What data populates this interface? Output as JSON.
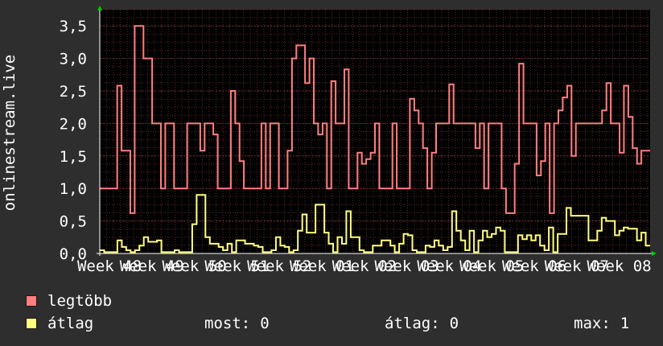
{
  "chart_data": {
    "type": "line",
    "ylabel": "onlinestream.live",
    "ylim": [
      0,
      3.75
    ],
    "yticks": [
      "0,0",
      "0,5",
      "1,0",
      "1,5",
      "2,0",
      "2,5",
      "3,0",
      "3,5"
    ],
    "ytick_values": [
      0,
      0.5,
      1.0,
      1.5,
      2.0,
      2.5,
      3.0,
      3.5
    ],
    "xticks": [
      "Week 48",
      "Week 49",
      "Week 50",
      "Week 51",
      "Week 52",
      "Week 01",
      "Week 02",
      "Week 03",
      "Week 04",
      "Week 05",
      "Week 06",
      "Week 07",
      "Week 08"
    ],
    "grid": true,
    "background": "#000000",
    "series": [
      {
        "name": "legtöbb",
        "color": "#ff7f7f",
        "values": [
          1,
          1,
          1,
          1,
          2.58,
          1.58,
          1.58,
          0.62,
          3.5,
          3.5,
          3.0,
          3.0,
          2.0,
          2.0,
          1.0,
          2.0,
          2.0,
          1.0,
          1.0,
          1.0,
          2.0,
          2.0,
          2.0,
          1.58,
          2.0,
          2.0,
          1.83,
          1.0,
          1.0,
          1.0,
          2.5,
          2.0,
          1.42,
          1.0,
          1.0,
          1.0,
          1.0,
          2.0,
          1.0,
          2.0,
          2.0,
          1.0,
          1.0,
          1.58,
          3.0,
          3.2,
          3.2,
          2.62,
          3.0,
          2.0,
          1.83,
          2.0,
          1.0,
          2.65,
          2.0,
          2.0,
          2.83,
          1.0,
          1.0,
          1.55,
          1.38,
          1.45,
          1.55,
          2.0,
          1.0,
          1.0,
          1.0,
          2.0,
          1.0,
          1.0,
          1.0,
          2.38,
          2.2,
          2.0,
          1.62,
          1.0,
          1.55,
          2.0,
          2.0,
          2.0,
          2.6,
          2.0,
          2.0,
          2.0,
          2.0,
          2.0,
          1.62,
          2.0,
          1.0,
          2.0,
          2.0,
          2.0,
          1.0,
          0.62,
          0.62,
          1.38,
          2.92,
          2.0,
          2.0,
          2.0,
          1.2,
          1.42,
          2.0,
          0.62,
          2.0,
          2.2,
          2.4,
          2.58,
          1.5,
          2.0,
          2.0,
          2.0,
          2.0,
          2.0,
          2.0,
          2.2,
          2.62,
          2.0,
          2.0,
          1.55,
          2.58,
          2.1,
          1.62,
          1.38,
          1.58,
          1.58
        ]
      },
      {
        "name": "átlag",
        "color": "#ffff80",
        "values": [
          0.05,
          0.02,
          0.02,
          0.02,
          0.2,
          0.1,
          0.05,
          0.02,
          0.05,
          0.12,
          0.25,
          0.18,
          0.18,
          0.2,
          0.02,
          0.02,
          0.02,
          0.05,
          0.02,
          0.02,
          0.02,
          0.45,
          0.9,
          0.9,
          0.25,
          0.15,
          0.15,
          0.1,
          0.05,
          0.15,
          0.02,
          0.2,
          0.2,
          0.15,
          0.15,
          0.12,
          0.1,
          0.02,
          0.02,
          0.05,
          0.25,
          0.12,
          0.1,
          0.02,
          0.05,
          0.35,
          0.6,
          0.32,
          0.32,
          0.75,
          0.75,
          0.32,
          0.15,
          0.02,
          0.25,
          0.15,
          0.65,
          0.25,
          0.25,
          0.05,
          0.02,
          0.02,
          0.12,
          0.12,
          0.2,
          0.2,
          0.12,
          0.02,
          0.15,
          0.3,
          0.28,
          0.05,
          0.02,
          0.02,
          0.12,
          0.1,
          0.2,
          0.12,
          0.05,
          0.1,
          0.65,
          0.35,
          0.2,
          0.05,
          0.35,
          0.02,
          0.2,
          0.35,
          0.25,
          0.3,
          0.4,
          0.35,
          0.02,
          0.02,
          0.02,
          0.28,
          0.22,
          0.28,
          0.2,
          0.28,
          0.12,
          0.05,
          0.4,
          0.02,
          0.3,
          0.3,
          0.7,
          0.58,
          0.58,
          0.58,
          0.58,
          0.2,
          0.2,
          0.35,
          0.55,
          0.5,
          0.5,
          0.28,
          0.35,
          0.4,
          0.38,
          0.38,
          0.2,
          0.32,
          0.12
        ]
      }
    ]
  },
  "legend": [
    {
      "label": "legtöbb",
      "color": "#ff7f7f"
    },
    {
      "label": "átlag",
      "color": "#ffff80"
    }
  ],
  "stats": {
    "most_label": "most:",
    "most_value": "0",
    "atlag_label": "átlag:",
    "atlag_value": "0",
    "max_label": "max:",
    "max_value": "1"
  }
}
